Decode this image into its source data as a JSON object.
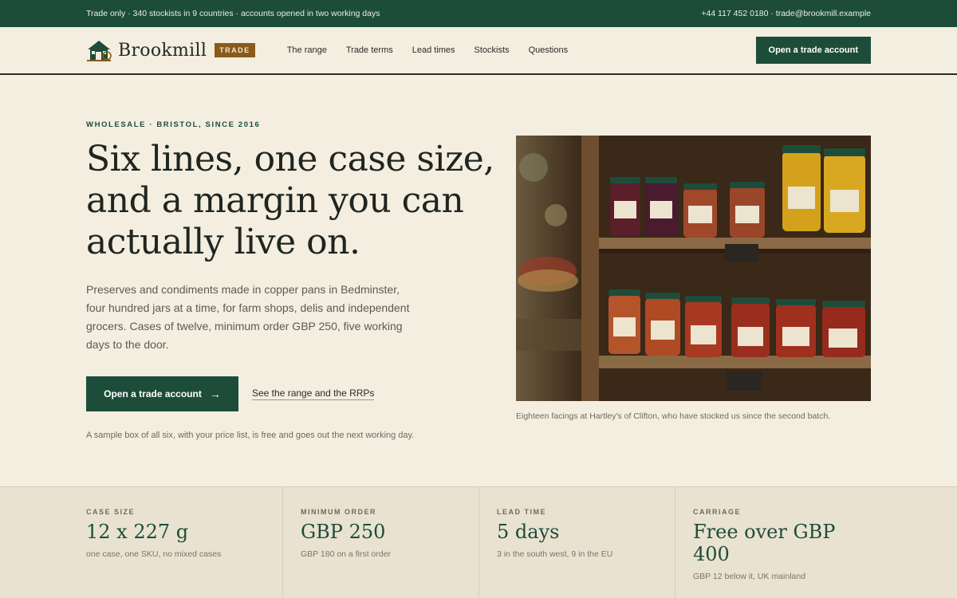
{
  "topbar": {
    "left": "Trade only · 340 stockists in 9 countries · accounts opened in two working days",
    "right": "+44 117 452 0180 · trade@brookmill.example"
  },
  "nav": {
    "brand": "Brookmill",
    "badge": "TRADE",
    "links": [
      "The range",
      "Trade terms",
      "Lead times",
      "Stockists",
      "Questions"
    ],
    "cta": "Open a trade account"
  },
  "hero": {
    "eyebrow": "WHOLESALE · BRISTOL, SINCE 2016",
    "headline": "Six lines, one case size, and a margin you can actually live on.",
    "lede": "Preserves and condiments made in copper pans in Bedminster, four hundred jars at a time, for farm shops, delis and independent grocers. Cases of twelve, minimum order GBP 250, five working days to the door.",
    "primary_cta": "Open a trade account",
    "secondary_cta": "See the range and the RRPs",
    "note": "A sample box of all six, with your price list, is free and goes out the next working day.",
    "caption": "Eighteen facings at Hartley's of Clifton, who have stocked us since the second batch."
  },
  "stats": [
    {
      "label": "CASE SIZE",
      "value": "12 x 227 g",
      "sub": "one case, one SKU, no mixed cases"
    },
    {
      "label": "MINIMUM ORDER",
      "value": "GBP 250",
      "sub": "GBP 180 on a first order"
    },
    {
      "label": "LEAD TIME",
      "value": "5 days",
      "sub": "3 in the south west, 9 in the EU"
    },
    {
      "label": "CARRIAGE",
      "value": "Free over GBP 400",
      "sub": "GBP 12 below it, UK mainland"
    }
  ],
  "colors": {
    "brand_green": "#1d4d3a",
    "badge_brown": "#8a5a1c",
    "background": "#f4eee0"
  },
  "icons": {
    "logo": "mill-house-icon",
    "arrow": "arrow-right-icon"
  }
}
